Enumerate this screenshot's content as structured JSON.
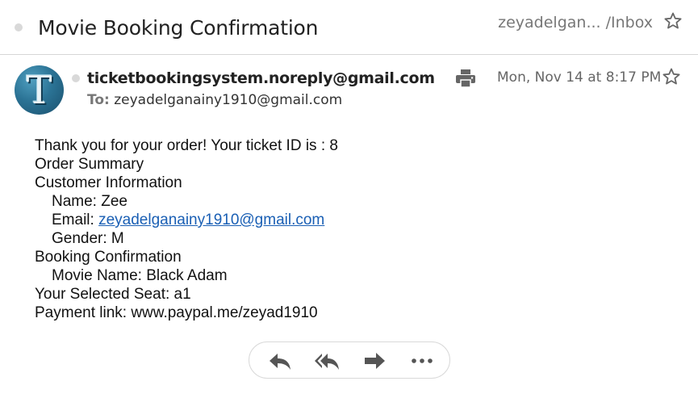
{
  "header": {
    "subject": "Movie Booking Confirmation",
    "folder": "zeyadelgan... /Inbox"
  },
  "message": {
    "avatar_letter": "T",
    "sender": "ticketbookingsystem.noreply@gmail.com",
    "to_label": "To:",
    "recipient": "zeyadelganainy1910@gmail.com",
    "date": "Mon, Nov 14 at 8:17 PM"
  },
  "body": {
    "thanks": "Thank you for your order! Your ticket ID is : 8",
    "order_summary": "Order Summary",
    "customer_info": "Customer Information",
    "name": "Name: Zee",
    "email_label": "Email:",
    "email_link": "zeyadelganainy1910@gmail.com",
    "gender": "Gender: M",
    "booking_confirmation": "Booking Confirmation",
    "movie_name": "Movie Name: Black Adam",
    "seat": "Your Selected Seat: a1",
    "payment": "Payment link: www.paypal.me/zeyad1910"
  },
  "actions": {
    "icons": [
      "reply-icon",
      "reply-all-icon",
      "forward-icon",
      "more-icon"
    ]
  },
  "colors": {
    "accent_link": "#1a5fb4",
    "icon_gray": "#555555",
    "divider": "#d6d6d6"
  }
}
